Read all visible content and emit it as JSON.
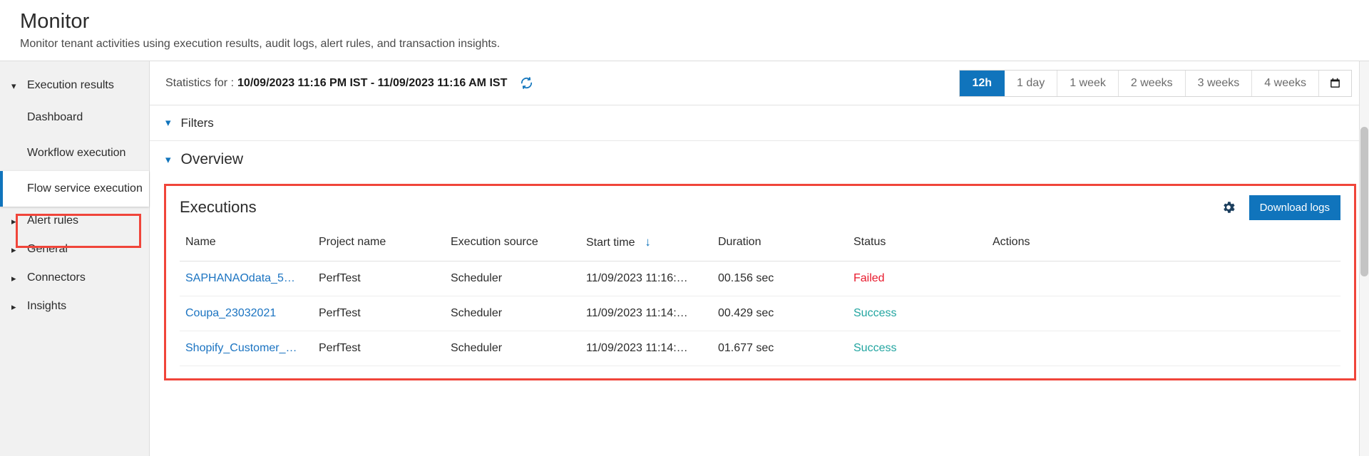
{
  "header": {
    "title": "Monitor",
    "subtitle": "Monitor tenant activities using execution results, audit logs, alert rules, and transaction insights."
  },
  "sidebar": {
    "groups": [
      {
        "label": "Execution results",
        "expanded": true,
        "icon": "chevron-down-icon"
      },
      {
        "label": "Alert rules",
        "expanded": false,
        "icon": "chevron-right-icon"
      },
      {
        "label": "General",
        "expanded": false,
        "icon": "chevron-right-icon"
      },
      {
        "label": "Connectors",
        "expanded": false,
        "icon": "chevron-right-icon"
      },
      {
        "label": "Insights",
        "expanded": false,
        "icon": "chevron-right-icon"
      }
    ],
    "sub_items": [
      {
        "label": "Dashboard",
        "selected": false
      },
      {
        "label": "Workflow execution",
        "selected": false
      },
      {
        "label": "Flow service execution",
        "selected": true
      }
    ],
    "highlight_color": "#f0453a",
    "selected_accent_color": "#1074bc"
  },
  "stats": {
    "label": "Statistics for :",
    "range": "10/09/2023 11:16 PM IST - 11/09/2023 11:16 AM IST",
    "refresh_icon": "refresh-icon"
  },
  "time_ranges": {
    "options": [
      {
        "label": "12h",
        "active": true
      },
      {
        "label": "1 day",
        "active": false
      },
      {
        "label": "1 week",
        "active": false
      },
      {
        "label": "2 weeks",
        "active": false
      },
      {
        "label": "3 weeks",
        "active": false
      },
      {
        "label": "4 weeks",
        "active": false
      }
    ],
    "calendar_icon": "calendar-icon",
    "active_color": "#1074bc"
  },
  "sections": [
    {
      "label": "Filters",
      "expanded": true,
      "icon": "chevron-down-icon"
    },
    {
      "label": "Overview",
      "expanded": true,
      "icon": "chevron-down-icon"
    }
  ],
  "executions": {
    "title": "Executions",
    "settings_icon": "gear-icon",
    "download_label": "Download logs",
    "download_color": "#1074bc",
    "columns": [
      {
        "label": "Name",
        "sorted": false
      },
      {
        "label": "Project name",
        "sorted": false
      },
      {
        "label": "Execution source",
        "sorted": false
      },
      {
        "label": "Start time",
        "sorted": true,
        "sort_dir": "desc",
        "sort_icon": "arrow-down-icon"
      },
      {
        "label": "Duration",
        "sorted": false
      },
      {
        "label": "Status",
        "sorted": false
      },
      {
        "label": "Actions",
        "sorted": false
      }
    ],
    "rows": [
      {
        "name": "SAPHANAOdata_5…",
        "project": "PerfTest",
        "source": "Scheduler",
        "start_time": "11/09/2023 11:16:…",
        "duration": "00.156 sec",
        "status": "Failed",
        "status_kind": "failed",
        "actions": ""
      },
      {
        "name": "Coupa_23032021",
        "project": "PerfTest",
        "source": "Scheduler",
        "start_time": "11/09/2023 11:14:…",
        "duration": "00.429 sec",
        "status": "Success",
        "status_kind": "success",
        "actions": ""
      },
      {
        "name": "Shopify_Customer_…",
        "project": "PerfTest",
        "source": "Scheduler",
        "start_time": "11/09/2023 11:14:…",
        "duration": "01.677 sec",
        "status": "Success",
        "status_kind": "success",
        "actions": ""
      }
    ],
    "status_colors": {
      "failed": "#e8192c",
      "success": "#22a5a0"
    },
    "link_color": "#1a73c1",
    "highlight_color": "#f0453a"
  }
}
